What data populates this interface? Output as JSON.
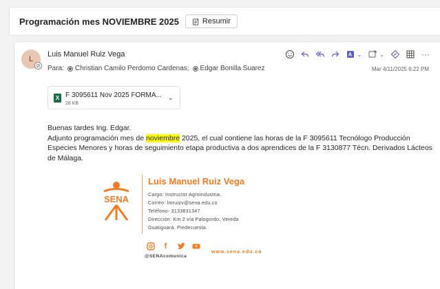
{
  "header": {
    "subject": "Programación mes NOVIEMBRE 2025",
    "summarize_label": "Resumir"
  },
  "message": {
    "avatar_initial": "L",
    "sender_name": "Luis Manuel Ruiz Vega",
    "to_label": "Para:",
    "recipients": [
      "Christian Camilo Perdomo Cardenas;",
      "Edgar Bonilla Suarez"
    ],
    "date": "Mar 4/11/2025 6:22 PM",
    "actions": [
      "emoji-icon",
      "reply-icon",
      "reply-all-icon",
      "forward-icon",
      "apps-icon",
      "more-options-icon",
      "link-icon",
      "grid-icon",
      "ellipsis-icon"
    ]
  },
  "attachment": {
    "name": "F 3095611 Nov 2025 FORMA...",
    "size": "28 KB",
    "type_badge": "X"
  },
  "body": {
    "greeting": "Buenas tardes Ing. Edgar.",
    "line1_pre": "Adjunto programación mes de ",
    "line1_highlight": "noviembre",
    "line1_post": " 2025, el cual contiene las horas de la F 3095611 Tecnólogo Producción Especies Menores y  horas de seguimiento etapa productiva a  dos aprendices de la F 3130877 Técn. Derivados Lácteos de Málaga."
  },
  "signature": {
    "logo_text": "SENA",
    "name": "Luis Manuel Ruiz Vega",
    "cargo": "Cargo: Instructor Agroindustria.",
    "correo": "Correo: lmruizv@sena.edu.co",
    "telefono": "Teléfono- 3133831347",
    "direccion": "Dirección: Km 2 vía Palogordo, Vereda",
    "localidad": "Guatiguará. Piedecuesta.",
    "handle": "@SENAcomunica",
    "website": "www.sena.edu.co"
  },
  "colors": {
    "accent": "#5b5fc7",
    "sena_orange": "#f47b20",
    "highlight": "#ffff00",
    "excel_green": "#1d6f42"
  }
}
